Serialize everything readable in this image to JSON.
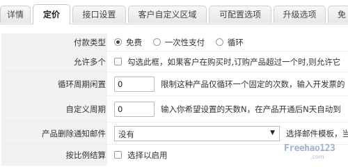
{
  "tabs": [
    {
      "label": "详情",
      "active": false
    },
    {
      "label": "定价",
      "active": true
    },
    {
      "label": "接口设置",
      "active": false
    },
    {
      "label": "客户自定义区域",
      "active": false
    },
    {
      "label": "可配置选项",
      "active": false
    },
    {
      "label": "升级选项",
      "active": false
    },
    {
      "label": "免",
      "active": false
    }
  ],
  "form": {
    "payment_type": {
      "label": "付款类型",
      "options": [
        {
          "label": "免费",
          "selected": true
        },
        {
          "label": "一次性支付",
          "selected": false
        },
        {
          "label": "循环",
          "selected": false
        }
      ]
    },
    "allow_multiple": {
      "label": "允许多个",
      "checked": false,
      "text": "勾选此框，如果客户在购买时,订购产品超过一个时,则允许它"
    },
    "recurring_cycle_limit": {
      "label": "循环周期闲置",
      "value": "0",
      "help": "限制这种产品仅循环一个固定的次数，输入开发票的"
    },
    "custom_period": {
      "label": "自定义周期",
      "value": "0",
      "help": "输入你希望设置的天数N，在产品开通后N天自动到"
    },
    "deletion_email": {
      "label": "产品删除通知邮件",
      "selected": "没有",
      "help": "选择邮件模板，当"
    },
    "prorata": {
      "label": "按比例结算",
      "checked": false,
      "text": "选择以启用"
    }
  },
  "watermark": {
    "text": "Freehao123",
    "sub": ".com"
  }
}
